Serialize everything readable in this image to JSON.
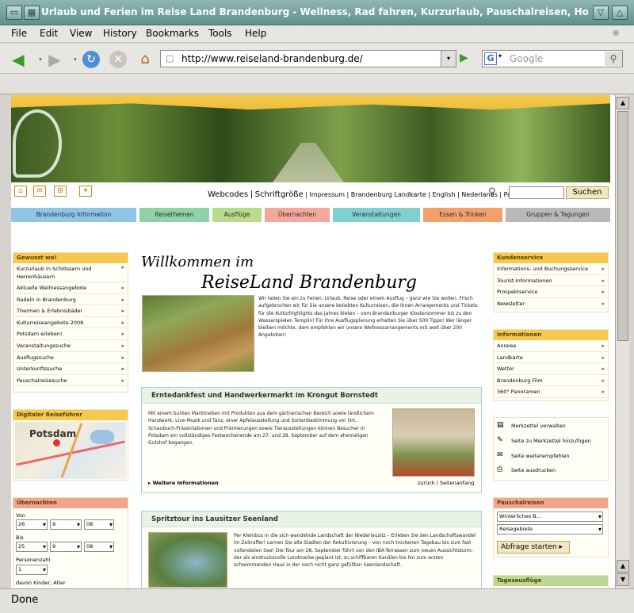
{
  "window": {
    "title": "Urlaub und Ferien im Reise Land Brandenburg - Wellness, Rad fahren, Kurzurlaub, Pauschalreisen, Hotels - Mozilla Firefox"
  },
  "menu": [
    "File",
    "Edit",
    "View",
    "History",
    "Bookmarks",
    "Tools",
    "Help"
  ],
  "nav": {
    "url": "http://www.reiseland-brandenburg.de/",
    "search_placeholder": "Google"
  },
  "status": {
    "text": "Done"
  },
  "site": {
    "toplinks": {
      "webcodes": "Webcodes",
      "sep1": "|",
      "schrift": "Schriftgröße",
      "rest": "| Impressum | Brandenburg Landkarte | English | Nederlands | Polski"
    },
    "search_button": "Suchen",
    "mainnav": [
      {
        "label": "Brandenburg Information",
        "color": "#8fc6e8"
      },
      {
        "label": "Reisethemen",
        "color": "#8fd2a6"
      },
      {
        "label": "Ausflüge",
        "color": "#b7dc8c"
      },
      {
        "label": "Übernachten",
        "color": "#f5a79b"
      },
      {
        "label": "Veranstaltungen",
        "color": "#7fd1d0"
      },
      {
        "label": "Essen & Trinken",
        "color": "#f4a06b"
      },
      {
        "label": "Gruppen & Tagungen",
        "color": "#b9b9b9"
      }
    ],
    "gewusst": {
      "title": "Gewusst wo!",
      "items": [
        "Kurzurlaub in Schlössern und Herrenhäusern",
        "Aktuelle Wellnessangebote",
        "Radeln in Brandenburg",
        "Thermen & Erlebnisbäder",
        "Kulturreiseangebote 2008",
        "Potsdam erleben!",
        "Veranstaltungssuche",
        "Ausflugssuche",
        "Unterkunftssuche",
        "Pauschalreisesuche"
      ]
    },
    "reisefuehrer": {
      "title": "Digitaler Reiseführer",
      "map_label": "Potsdam"
    },
    "uebernachten": {
      "title": "Übernachten",
      "von": "Von",
      "bis": "Bis",
      "von_d": "26",
      "von_m": "9",
      "von_y": "08",
      "bis_d": "25",
      "bis_m": "9",
      "bis_y": "08",
      "personen_label": "Personenzahl",
      "personen": "1",
      "kinder": "davon Kinder, Alter"
    },
    "welcome": {
      "line1": "Willkommen im",
      "line2": "ReiseLand Brandenburg",
      "text": "Wir laden Sie ein zu Ferien, Urlaub, Reise oder einem Ausflug – ganz wie Sie wollen. Frisch aufgebrochen wir für Sie unsere beliebten Kulturreisen, die Ihnen Arrangements und Tickets für die Kulturhighlights des Jahres bieten – vom Brandenburger Klostersommer bis zu den Wasserspielen Templin! Für Ihre Ausflugsplanung erhalten Sie über 500 Tipps! Wer länger bleiben möchte, dem empfehlen wir unsere Wellnessarrangements mit weit über 200 Angeboten!"
    },
    "news1": {
      "title": "Erntedankfest und Handwerkermarkt im Krongut Bornstedt",
      "text": "Mit einem bunten Marktreiben mit Produkten aus dem gärtnerischen Bereich sowie ländlichem Handwerk, Live-Musik und Tanz, einer Apfelausstellung und Sortenbestimmung vor Ort, Schaubuch-Präsentationen und Prämierungen sowie Tierausstellungen können Besucher in Potsdam ein vollständiges Festwochenende am 27. und 28. September auf dem ehemaligen Gutshof begangen.",
      "more": "Weitere Informationen",
      "links": "zurück | Seitenanfang"
    },
    "news2": {
      "title": "Spritztour ins Lausitzer Seenland",
      "text": "Per Kleinbus in die sich wandelnde Landschaft der Niederlausitz – Erleben Sie den Landschaftswandel im Zeitraffer! Lernen Sie alle Stadien der Rekultivierung – von noch trockenen Tagebau bis zum fast vollendeten See! Die Tour am 28. September führt von den IBA-Terrassen zum neuen Aussichtsturm, der als eindrucksvolle Landmarke geplant ist, zu schiffbaren Kanälen bis hin zum ersten schwimmenden Haus in der noch nicht ganz gefüllten Seenlandschaft."
    },
    "kundenservice": {
      "title": "Kundenservice",
      "items": [
        "Informations- und Buchungsservice",
        "Tourist-Informationen",
        "Prospektservice",
        "Newsletter"
      ]
    },
    "informationen": {
      "title": "Informationen",
      "items": [
        "Anreise",
        "Landkarte",
        "Wetter",
        "Brandenburg Film",
        "360° Panoramen"
      ]
    },
    "merkzettel": {
      "items": [
        "Merkzettel verwalten",
        "Seite zu Merkzettel hinzufügen",
        "Seite weiterempfehlen",
        "Seite ausdrucken"
      ]
    },
    "pauschal": {
      "title": "Pauschalreisen",
      "sel1": "Winterliches B...",
      "sel2": "Reisegebiete",
      "button": "Abfrage starten"
    },
    "tagesausfluege": {
      "title": "Tagesausflüge"
    }
  }
}
